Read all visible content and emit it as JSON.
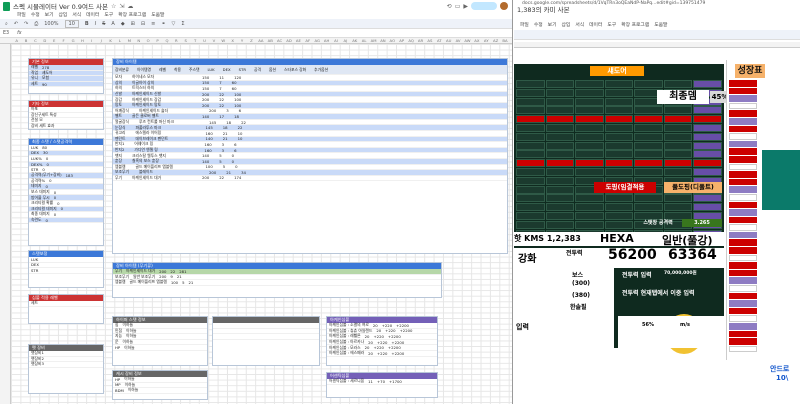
{
  "left_window": {
    "title": "스펙 시뮬레이터 Ver 0.9여드 사본",
    "menu": [
      "파일",
      "수정",
      "보기",
      "삽입",
      "서식",
      "데이터",
      "도구",
      "확장 프로그램",
      "도움말"
    ],
    "toolbar": {
      "zoom": "100%",
      "font_size": "10"
    },
    "formula": {
      "cell_ref": "E3",
      "fx": "fx"
    },
    "columns": [
      "A",
      "B",
      "C",
      "D",
      "E",
      "F",
      "G",
      "H",
      "I",
      "J",
      "K",
      "L",
      "M",
      "N",
      "O",
      "P",
      "Q",
      "R",
      "S",
      "T",
      "U",
      "V",
      "W",
      "X",
      "Y",
      "Z",
      "AA",
      "AB",
      "AC",
      "AD",
      "AE",
      "AF",
      "AG",
      "AH",
      "AI",
      "AJ",
      "AK",
      "AL",
      "AM",
      "AN",
      "AO",
      "AP",
      "AQ",
      "AR",
      "AS",
      "AT",
      "AU",
      "AV",
      "AW",
      "AX",
      "AY",
      "AZ",
      "BA"
    ],
    "basic_info": {
      "header": "기본 정보",
      "rows": [
        [
          "레벨",
          "278"
        ],
        [
          "직업",
          "섀도어"
        ],
        [
          "유니",
          "모험"
        ],
        [
          "세트",
          "90"
        ]
      ]
    },
    "other_info": {
      "header": "기타 정보",
      "rows": [
        "아포",
        "장신구세트 특성",
        "전설 모",
        "장비 세트 효과"
      ]
    },
    "stat_panel": {
      "header": "최종 스탯 / 스탯공격력",
      "rows": [
        [
          "LUK",
          "80"
        ],
        [
          "DEX",
          "30"
        ],
        [
          "LUK%",
          "0"
        ],
        [
          "DEX%",
          "0"
        ],
        [
          "STR",
          "0"
        ],
        [
          "공격력(무기+장비)",
          "183"
        ],
        [
          "공격력%",
          "0"
        ],
        [
          "데미지",
          "0"
        ],
        [
          "보스 데미지",
          "0"
        ],
        [
          "방어율 무시",
          "0"
        ],
        [
          "크리티컬 확률",
          "0"
        ],
        [
          "크리티컬 데미지",
          "0"
        ],
        [
          "최종 데미지",
          "0"
        ],
        [
          "숙련도",
          "0"
        ]
      ]
    },
    "equip_panel": {
      "header": "장비 아이템",
      "columns": [
        "장비분류",
        "아이템명",
        "레벨",
        "착용",
        "주스탯",
        "LUK",
        "DEX",
        "STR",
        "공격",
        "옵션",
        "스타포스 강화",
        "추가옵션"
      ],
      "rows": [
        [
          "모자",
          "하이네스 모자",
          "150",
          "11",
          "120"
        ],
        [
          "상의",
          "이글아이 상의",
          "150",
          "7",
          "60"
        ],
        [
          "하의",
          "트릭스터 하의",
          "150",
          "7",
          "60"
        ],
        [
          "신발",
          "아케인셰이드 신발",
          "200",
          "22",
          "100"
        ],
        [
          "장갑",
          "아케인셰이드 장갑",
          "200",
          "22",
          "100"
        ],
        [
          "망토",
          "아케인셰이드 망토",
          "200",
          "22",
          "100"
        ],
        [
          "어깨장식",
          "아케인셰이드 숄더",
          "200",
          "3",
          "6"
        ],
        [
          "벨트",
          "골든 클로버 벨트",
          "140",
          "17",
          "18"
        ],
        [
          "얼굴장식",
          "루즈 컨트롤 머신 마크",
          "145",
          "18",
          "22"
        ],
        [
          "눈장식",
          "파풀라투스 마크",
          "145",
          "18",
          "22"
        ],
        [
          "귀고리",
          "에스텔라 이어링",
          "160",
          "21",
          "10"
        ],
        [
          "펜던트",
          "데이브레이크 펜던트",
          "140",
          "21",
          "10"
        ],
        [
          "반지1",
          "어웨이크 링",
          "160",
          "3",
          "6"
        ],
        [
          "반지2",
          "가디언 엔젤 링",
          "160",
          "3",
          "6"
        ],
        [
          "뱃지",
          "크리스탈 웬투스 뱃지",
          "140",
          "5",
          "0"
        ],
        [
          "훈장",
          "칠흑의 보스 훈장",
          "140",
          "5",
          "0"
        ],
        [
          "엠블렘",
          "골드 메이플리프 엠블렘",
          "100",
          "5",
          "0"
        ],
        [
          "보조무기",
          "블레이드",
          "200",
          "21",
          "34"
        ],
        [
          "무기",
          "아케인셰이드 대거",
          "200",
          "22",
          "174"
        ]
      ]
    },
    "weapon_panel": {
      "header": "장비 아이템 (무기류)",
      "rows": [
        [
          "무기",
          "아케인셰이드 대거",
          "200",
          "22",
          "281"
        ],
        [
          "보조무기",
          "일반 보조무기",
          "200",
          "9",
          "21"
        ],
        [
          "엠블렘",
          "골드 메이플리프 엠블렘",
          "100",
          "5",
          "21"
        ]
      ]
    },
    "symbol_panel": {
      "header": "심볼 적용 레벨",
      "rows": [
        [
          "세트",
          "",
          "",
          ""
        ]
      ]
    },
    "arcane_panel": {
      "header": "아케인심볼",
      "columns": [
        "아이템명",
        "레벨",
        "ARC",
        "LUK"
      ],
      "rows": [
        [
          "아케인심볼 : 소멸의 여로",
          "20",
          "+220",
          "+2200"
        ],
        [
          "아케인심볼 : 츄츄 아일랜드",
          "20",
          "+220",
          "+2200"
        ],
        [
          "아케인심볼 : 레헬른",
          "20",
          "+220",
          "+2200"
        ],
        [
          "아케인심볼 : 아르카나",
          "20",
          "+220",
          "+2200"
        ],
        [
          "아케인심볼 : 모라스",
          "20",
          "+220",
          "+2200"
        ],
        [
          "아케인심볼 : 에스페라",
          "20",
          "+220",
          "+2200"
        ]
      ]
    },
    "authentic_panel": {
      "header": "어센틱심볼",
      "columns": [
        "아이템명",
        "레벨",
        "AUT",
        "LUK"
      ],
      "rows": [
        [
          "어센틱심볼 : 세르니움",
          "11",
          "+70",
          "+1700"
        ]
      ]
    },
    "pet_panel": {
      "header": "펫 장비",
      "rows": [
        [
          "펫장비1"
        ],
        [
          "펫장비2"
        ],
        [
          "펫장비3"
        ]
      ]
    },
    "weapon_grey": {
      "header": "하이퍼 스탯 정보",
      "rows": [
        [
          "힘",
          "이하늘"
        ],
        [
          "민첩",
          "이하늘"
        ],
        [
          "지능",
          "이하늘"
        ],
        [
          "운",
          "이하늘"
        ],
        [
          "HP",
          "이하늘"
        ]
      ]
    },
    "grey2": {
      "header": "캐시 장비 정보",
      "rows": [
        [
          "HP",
          "이하늘"
        ],
        [
          "MP",
          "이하늘"
        ],
        [
          "BDM",
          "이하늘"
        ],
        [
          "IED",
          "이하늘"
        ]
      ]
    }
  },
  "right_window": {
    "title": "1,383의 카미 사본",
    "url": "docs.google.com/spreadsheets/d/1VqTRn3oQEaNdP-NaPq...edit#gid=139751479",
    "menu": [
      "파일",
      "수정",
      "보기",
      "삽입",
      "서식",
      "데이터",
      "도구",
      "확장 프로그램",
      "도움말"
    ],
    "job_badge": "섀도어",
    "final_label": "최종뎀",
    "final_value": "45%",
    "growth_label": "성장표",
    "potion_label": "도핑(임결적용",
    "dodge_label": "풀도핑(디폴트)",
    "attack_label": "스탯창 공격력",
    "attack_value": "3.265",
    "kms_label": "핫 KMS 1,2,383",
    "hexa_label": "HEXA",
    "normal_label": "일반(풀강)",
    "enhance_label": "강화",
    "combat_label": "전투력",
    "combat_hexa": "56200",
    "combat_normal": "63364",
    "boss_label": "보스",
    "boss_sub": "(300)",
    "boss_sub2": "(380)",
    "union_label": "한솔필",
    "input_label": "입력",
    "bubble_text": "전투력 현재탭에서 이중 입력",
    "mini_label": "전투력 입력",
    "mini_value": "70,000,000원",
    "mp_label": "m/s",
    "percent_value": "56%",
    "sidebar_label": "안드로",
    "sidebar_num": "10\\",
    "green_label": "스탯보정"
  }
}
